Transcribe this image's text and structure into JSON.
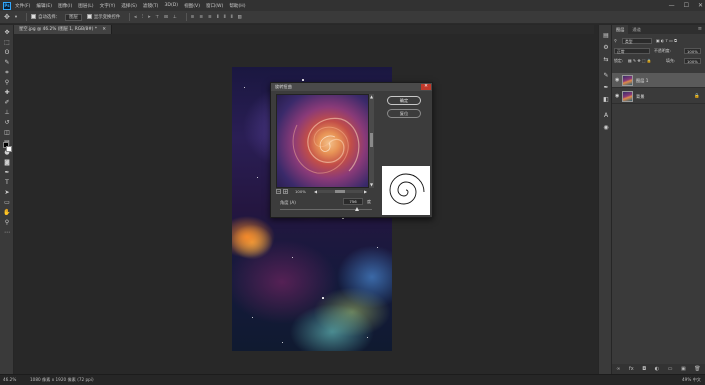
{
  "app": {
    "logo": "Ps",
    "menu": [
      "文件(F)",
      "编辑(E)",
      "图像(I)",
      "图层(L)",
      "文字(Y)",
      "选择(S)",
      "滤镜(T)",
      "3D(D)",
      "视图(V)",
      "窗口(W)",
      "帮助(H)"
    ],
    "window_controls": [
      "—",
      "☐",
      "✕"
    ]
  },
  "options_bar": {
    "move_tool_icon": "move-icon",
    "auto_select_label": "自动选择：",
    "auto_select_value": "图层",
    "show_transform_label": "显示变换控件"
  },
  "document": {
    "tab_label": "星空.jpg @ 46.2% (图层 1, RGB/8#) *"
  },
  "dialog": {
    "title": "旋转扭曲",
    "close": "✕",
    "ok_label": "确定",
    "cancel_label": "复位",
    "zoom_out": "−",
    "zoom_in": "+",
    "zoom_value": "100%",
    "angle_label": "角度 (A)",
    "angle_value": "756",
    "angle_unit": "度"
  },
  "layers_panel": {
    "tabs": [
      "图层",
      "通道"
    ],
    "menu_icon": "≡",
    "kind_label": "类型",
    "blend_mode": "正常",
    "opacity_label": "不透明度:",
    "opacity_value": "100%",
    "lock_label": "锁定:",
    "fill_label": "填充:",
    "fill_value": "100%",
    "layers": [
      {
        "name": "图层 1",
        "selected": true,
        "locked": false
      },
      {
        "name": "背景",
        "selected": false,
        "locked": true
      }
    ],
    "bottom_icons": [
      "∞",
      "fx",
      "◘",
      "◐",
      "▭",
      "▣",
      "🗑"
    ]
  },
  "status": {
    "zoom": "46.2%",
    "doc_info": "1080 像素 x 1920 像素 (72 ppi)",
    "right_text": "49% 中文"
  },
  "colors": {
    "chrome": "#323232",
    "panel": "#3a3a3a",
    "canvas_bg": "#282828",
    "accent": "#31a8ff"
  }
}
